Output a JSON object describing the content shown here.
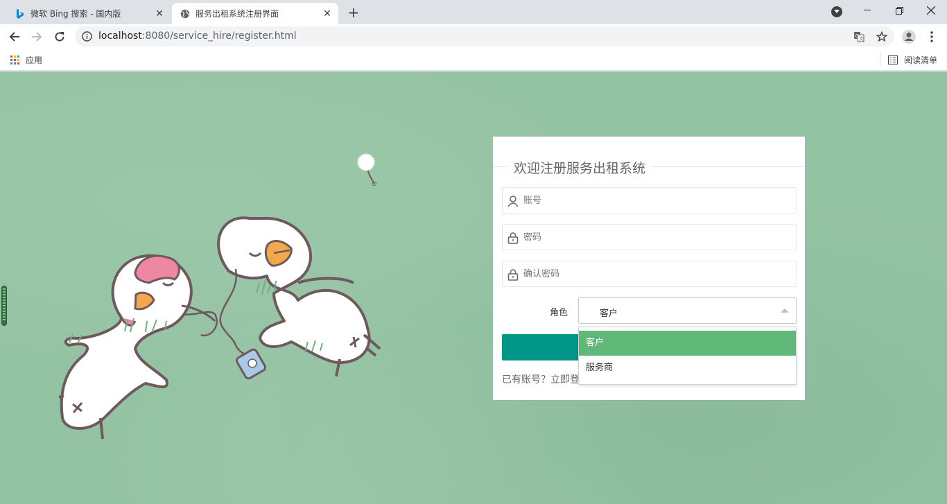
{
  "browser": {
    "tabs": [
      {
        "title": "微软 Bing 搜索 - 国内版",
        "active": false,
        "icon": "bing-icon"
      },
      {
        "title": "服务出租系统注册界面",
        "active": true,
        "icon": "globe-icon"
      }
    ],
    "url_host": "localhost",
    "url_path": ":8080/service_hire/register.html",
    "bookmarks": {
      "apps_label": "应用",
      "reading_list_label": "阅读清单"
    }
  },
  "register": {
    "heading": "欢迎注册服务出租系统",
    "account_placeholder": "账号",
    "password_placeholder": "密码",
    "confirm_placeholder": "确认密码",
    "role_label": "角色",
    "role_selected": "客户",
    "role_options": [
      "客户",
      "服务商"
    ],
    "login_prompt": "已有账号？立即登"
  },
  "colors": {
    "background": "#94c3a3",
    "submit_button": "#009688",
    "option_selected": "#5fb878"
  }
}
